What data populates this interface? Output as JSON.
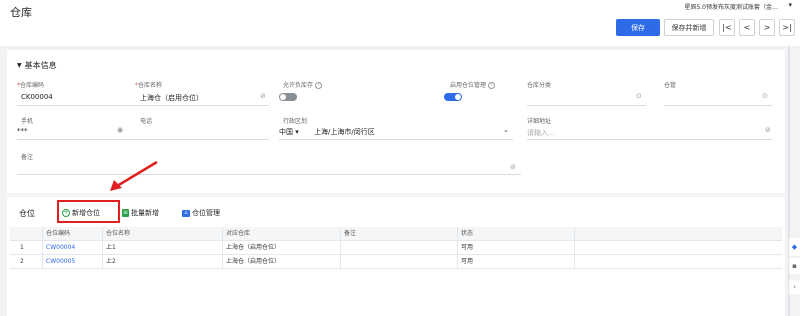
{
  "header": {
    "title": "仓库",
    "account": "星辰5.0预发布灰度测试账套（金…",
    "save_label": "保存",
    "save_new_label": "保存并新增",
    "nav": [
      "|<",
      "<",
      ">",
      ">|"
    ]
  },
  "basic_info": {
    "section_title": "基本信息",
    "warehouse_code": {
      "label": "仓库编码",
      "value": "CK00004"
    },
    "warehouse_name": {
      "label": "仓库名称",
      "value": "上海仓（启用仓位）"
    },
    "allow_negative": {
      "label": "允许负库存",
      "on": false
    },
    "enable_bins": {
      "label": "启用仓位管理",
      "on": true
    },
    "category": {
      "label": "仓库分类",
      "value": ""
    },
    "keeper": {
      "label": "仓管",
      "value": ""
    },
    "phone": {
      "label": "手机",
      "value": "***"
    },
    "tel": {
      "label": "电话",
      "value": ""
    },
    "region": {
      "label": "行政区划",
      "country": "中国",
      "value": "上海/上海市/闵行区"
    },
    "address": {
      "label": "详细地址",
      "placeholder": "请输入..."
    },
    "remark": {
      "label": "备注",
      "value": ""
    }
  },
  "bins": {
    "title": "仓位",
    "add_label": "新增仓位",
    "batch_label": "批量新增",
    "manage_label": "仓位管理",
    "columns": [
      "",
      "仓位编码",
      "仓位名称",
      "对应仓库",
      "备注",
      "状态",
      ""
    ],
    "rows": [
      {
        "index": "1",
        "code": "CW00004",
        "name": "上1",
        "warehouse": "上海仓（启用仓位）",
        "remark": "",
        "status": "可用"
      },
      {
        "index": "2",
        "code": "CW00005",
        "name": "上2",
        "warehouse": "上海仓（启用仓位）",
        "remark": "",
        "status": "可用"
      }
    ]
  },
  "colors": {
    "accent": "#2e6be6",
    "highlight": "#e02020",
    "toggle_off": "#8a8f96",
    "green": "#2aa147"
  },
  "icons": [
    "eye-icon",
    "clear-icon",
    "ellipsis-icon",
    "help-icon",
    "chevron-down-icon",
    "plus-circle-icon",
    "batch-add-icon",
    "warehouse-icon",
    "arrow-annotation"
  ]
}
